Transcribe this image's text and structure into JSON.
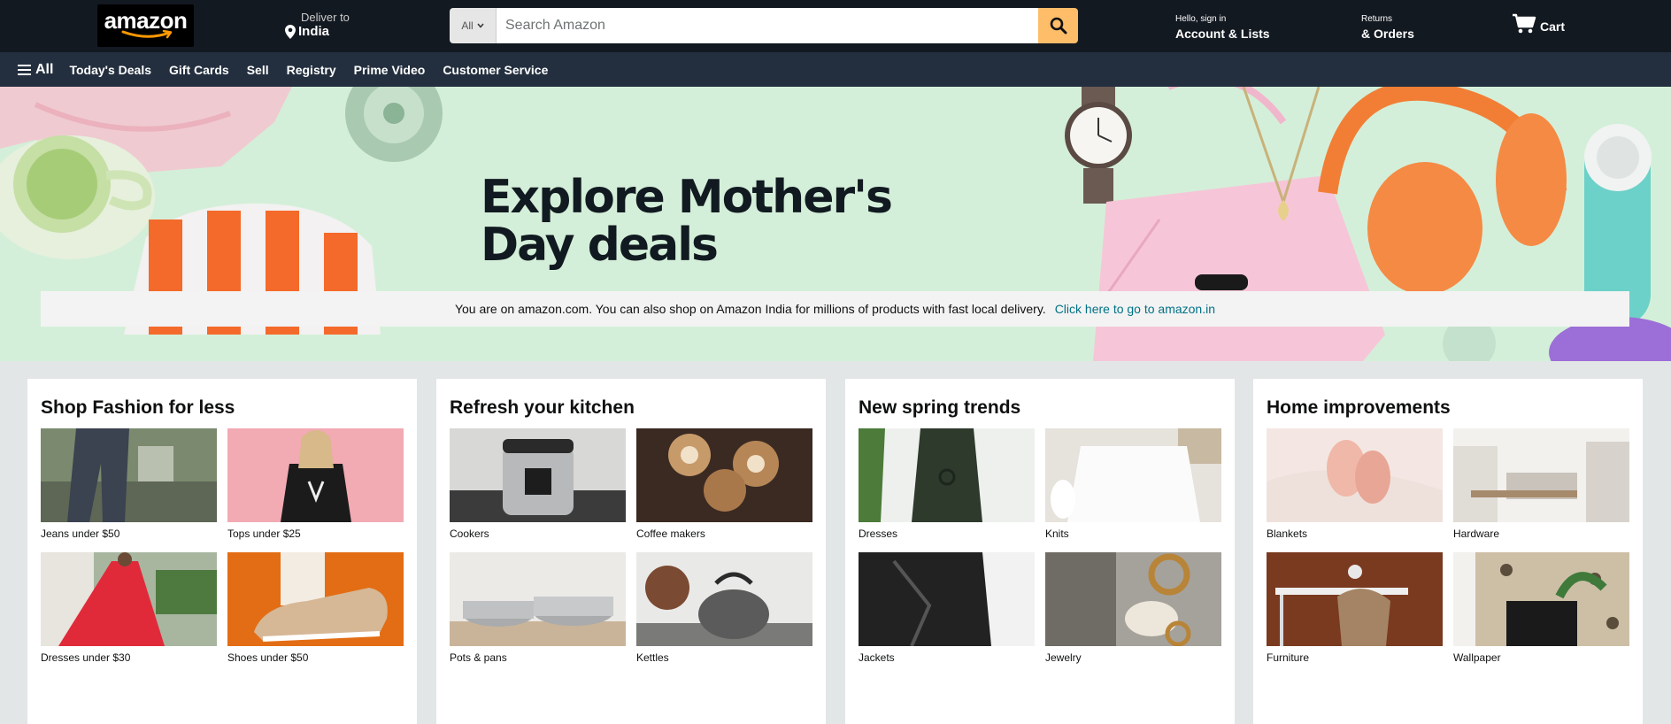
{
  "header": {
    "logo_text": "amazon",
    "deliver_line1": "Deliver to",
    "deliver_line2": "India",
    "search_category": "All",
    "search_placeholder": "Search Amazon",
    "account_line1": "Hello, sign in",
    "account_line2": "Account & Lists",
    "orders_line1": "Returns",
    "orders_line2": "& Orders",
    "cart_label": "Cart"
  },
  "nav": {
    "all_label": "All",
    "items": [
      "Today's Deals",
      "Gift Cards",
      "Sell",
      "Registry",
      "Prime Video",
      "Customer Service"
    ]
  },
  "hero": {
    "title_line1": "Explore Mother's",
    "title_line2": "Day deals"
  },
  "notice": {
    "text": "You are on amazon.com. You can also shop on Amazon India for millions of products with fast local delivery.",
    "link": "Click here to go to amazon.in"
  },
  "cards": [
    {
      "title": "Shop Fashion for less",
      "tiles": [
        "Jeans under $50",
        "Tops under $25",
        "Dresses under $30",
        "Shoes under $50"
      ]
    },
    {
      "title": "Refresh your kitchen",
      "tiles": [
        "Cookers",
        "Coffee makers",
        "Pots & pans",
        "Kettles"
      ]
    },
    {
      "title": "New spring trends",
      "tiles": [
        "Dresses",
        "Knits",
        "Jackets",
        "Jewelry"
      ]
    },
    {
      "title": "Home improvements",
      "tiles": [
        "Blankets",
        "Hardware",
        "Furniture",
        "Wallpaper"
      ]
    }
  ],
  "colors": {
    "header_bg": "#131921",
    "nav_bg": "#232f3e",
    "search_button": "#febd69",
    "hero_bg": "#d4efd9",
    "link": "#007185",
    "page_bg": "#e3e6e6"
  }
}
